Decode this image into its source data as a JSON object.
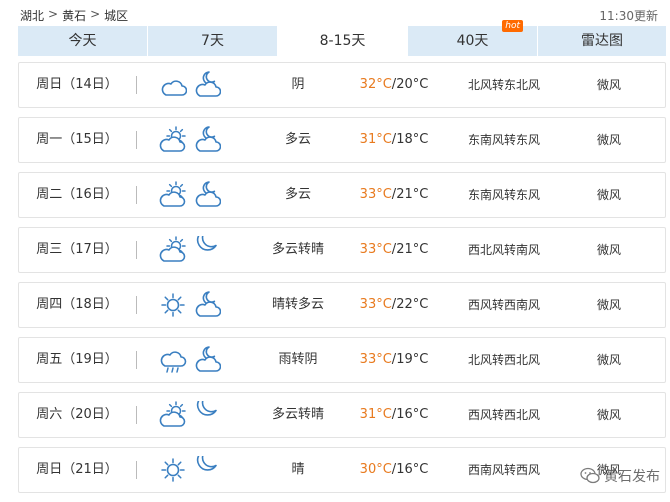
{
  "breadcrumb": {
    "province": "湖北",
    "city": "黄石",
    "district": "城区",
    "separator": ">"
  },
  "updated": "11:30更新",
  "tabs": [
    {
      "label": "今天",
      "active": false
    },
    {
      "label": "7天",
      "active": false
    },
    {
      "label": "8-15天",
      "active": true
    },
    {
      "label": "40天",
      "active": false,
      "badge": "hot"
    },
    {
      "label": "雷达图",
      "active": false
    }
  ],
  "rows": [
    {
      "date": "周日（14日）",
      "day_icon": "cloudy",
      "night_icon": "partly-cloudy-night",
      "desc": "阴",
      "high": "32°C",
      "low": "20°C",
      "wind": "北风转东北风",
      "level": "微风"
    },
    {
      "date": "周一（15日）",
      "day_icon": "partly-cloudy",
      "night_icon": "partly-cloudy-night",
      "desc": "多云",
      "high": "31°C",
      "low": "18°C",
      "wind": "东南风转东风",
      "level": "微风"
    },
    {
      "date": "周二（16日）",
      "day_icon": "partly-cloudy",
      "night_icon": "partly-cloudy-night",
      "desc": "多云",
      "high": "33°C",
      "low": "21°C",
      "wind": "东南风转东风",
      "level": "微风"
    },
    {
      "date": "周三（17日）",
      "day_icon": "partly-cloudy",
      "night_icon": "moon",
      "desc": "多云转晴",
      "high": "33°C",
      "low": "21°C",
      "wind": "西北风转南风",
      "level": "微风"
    },
    {
      "date": "周四（18日）",
      "day_icon": "sun",
      "night_icon": "partly-cloudy-night",
      "desc": "晴转多云",
      "high": "33°C",
      "low": "22°C",
      "wind": "西风转西南风",
      "level": "微风"
    },
    {
      "date": "周五（19日）",
      "day_icon": "rain-cloud",
      "night_icon": "partly-cloudy-night",
      "desc": "雨转阴",
      "high": "33°C",
      "low": "19°C",
      "wind": "北风转西北风",
      "level": "微风"
    },
    {
      "date": "周六（20日）",
      "day_icon": "partly-cloudy",
      "night_icon": "moon",
      "desc": "多云转晴",
      "high": "31°C",
      "low": "16°C",
      "wind": "西风转西北风",
      "level": "微风"
    },
    {
      "date": "周日（21日）",
      "day_icon": "sun",
      "night_icon": "moon",
      "desc": "晴",
      "high": "30°C",
      "low": "16°C",
      "wind": "西南风转西风",
      "level": "微风"
    }
  ],
  "watermark": "黄石发布",
  "colors": {
    "icon": "#3a7fc1",
    "high_temp": "#e87a1e",
    "tab_bg": "#dbeaf6"
  }
}
